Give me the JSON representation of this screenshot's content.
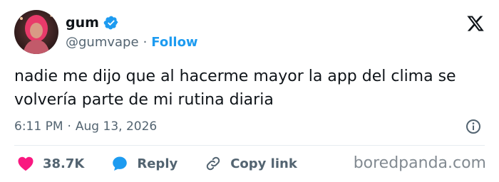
{
  "tweet": {
    "author": {
      "name": "gum",
      "handle": "@gumvape",
      "verified": true
    },
    "follow_separator": "·",
    "follow_label": "Follow",
    "text": "nadie me dijo que al hacerme mayor la app del clima se volvería parte de mi rutina diaria",
    "time": "6:11 PM",
    "date_separator": "·",
    "date": "Aug 13, 2026",
    "actions": {
      "likes": "38.7K",
      "reply_label": "Reply",
      "copy_label": "Copy link"
    }
  },
  "watermark": "boredpanda.com",
  "colors": {
    "accent": "#1d9bf0",
    "like_heart": "#f91880",
    "text_primary": "#0f1419",
    "text_secondary": "#536471"
  },
  "icons": [
    "avatar",
    "verified-badge-icon",
    "x-logo-icon",
    "info-icon",
    "heart-icon",
    "reply-bubble-icon",
    "link-icon"
  ]
}
